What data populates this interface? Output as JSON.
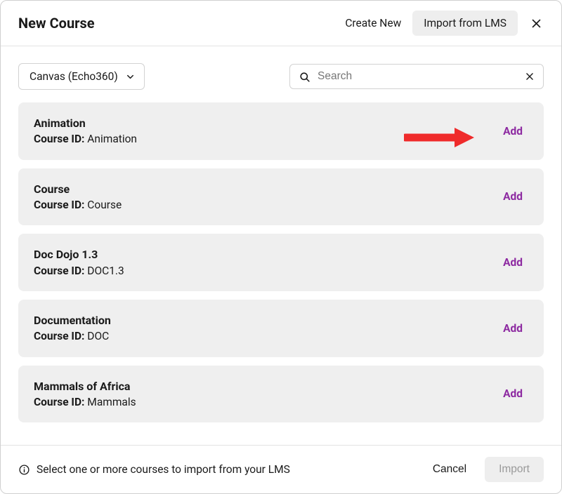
{
  "header": {
    "title": "New Course",
    "tab_create": "Create New",
    "tab_import": "Import from LMS"
  },
  "controls": {
    "dropdown_label": "Canvas (Echo360)",
    "search_placeholder": "Search"
  },
  "course_id_label": "Course ID:",
  "add_label": "Add",
  "courses": [
    {
      "name": "Animation",
      "id": "Animation"
    },
    {
      "name": "Course",
      "id": "Course"
    },
    {
      "name": "Doc Dojo 1.3",
      "id": "DOC1.3"
    },
    {
      "name": "Documentation",
      "id": "DOC"
    },
    {
      "name": "Mammals of Africa",
      "id": "Mammals"
    }
  ],
  "footer": {
    "info": "Select one or more courses to import from your LMS",
    "cancel": "Cancel",
    "import": "Import"
  }
}
